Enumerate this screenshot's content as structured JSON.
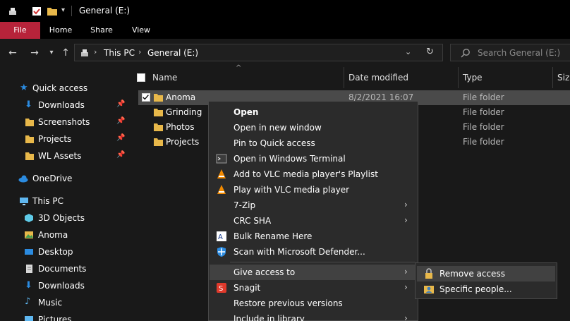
{
  "window": {
    "title": "General (E:)"
  },
  "ribbon": {
    "tabs": [
      "File",
      "Home",
      "Share",
      "View"
    ]
  },
  "address": {
    "crumbs": [
      "This PC",
      "General (E:)"
    ]
  },
  "search": {
    "placeholder": "Search General (E:)"
  },
  "nav": {
    "quick_access": "Quick access",
    "quick_items": [
      "Downloads",
      "Screenshots",
      "Projects",
      "WL Assets"
    ],
    "onedrive": "OneDrive",
    "this_pc": "This PC",
    "pc_items": [
      "3D Objects",
      "Anoma",
      "Desktop",
      "Documents",
      "Downloads",
      "Music",
      "Pictures"
    ]
  },
  "columns": {
    "name": "Name",
    "date": "Date modified",
    "type": "Type",
    "size": "Size"
  },
  "files": [
    {
      "name": "Anoma",
      "date": "8/2/2021 16:07",
      "type": "File folder",
      "selected": true
    },
    {
      "name": "Grinding",
      "date": "",
      "type": "File folder",
      "selected": false
    },
    {
      "name": "Photos",
      "date": "",
      "type": "File folder",
      "selected": false
    },
    {
      "name": "Projects",
      "date": "",
      "type": "File folder",
      "selected": false
    }
  ],
  "context_menu": {
    "items": [
      {
        "label": "Open",
        "icon": "none",
        "bold": true,
        "submenu": false
      },
      {
        "label": "Open in new window",
        "icon": "none",
        "bold": false,
        "submenu": false
      },
      {
        "label": "Pin to Quick access",
        "icon": "none",
        "bold": false,
        "submenu": false
      },
      {
        "label": "Open in Windows Terminal",
        "icon": "terminal-icon",
        "bold": false,
        "submenu": false
      },
      {
        "label": "Add to VLC media player's Playlist",
        "icon": "vlc-icon",
        "bold": false,
        "submenu": false
      },
      {
        "label": "Play with VLC media player",
        "icon": "vlc-icon",
        "bold": false,
        "submenu": false
      },
      {
        "label": "7-Zip",
        "icon": "none",
        "bold": false,
        "submenu": true
      },
      {
        "label": "CRC SHA",
        "icon": "none",
        "bold": false,
        "submenu": true
      },
      {
        "label": "Bulk Rename Here",
        "icon": "bulk-rename-icon",
        "bold": false,
        "submenu": false
      },
      {
        "label": "Scan with Microsoft Defender...",
        "icon": "defender-shield-icon",
        "bold": false,
        "submenu": false
      },
      {
        "label": "Give access to",
        "icon": "none",
        "bold": false,
        "submenu": true,
        "highlighted": true
      },
      {
        "label": "Snagit",
        "icon": "snagit-icon",
        "bold": false,
        "submenu": true
      },
      {
        "label": "Restore previous versions",
        "icon": "none",
        "bold": false,
        "submenu": false
      },
      {
        "label": "Include in library",
        "icon": "none",
        "bold": false,
        "submenu": true
      }
    ]
  },
  "submenu": {
    "items": [
      {
        "label": "Remove access",
        "icon": "lock-icon",
        "highlighted": true
      },
      {
        "label": "Specific people...",
        "icon": "people-icon",
        "highlighted": false
      }
    ]
  },
  "colors": {
    "file_tab": "#b7233a",
    "folder": "#e8b84a",
    "selection": "#4a4a4a",
    "menu_bg": "#2b2b2b",
    "accent_blue": "#2b8be0"
  }
}
